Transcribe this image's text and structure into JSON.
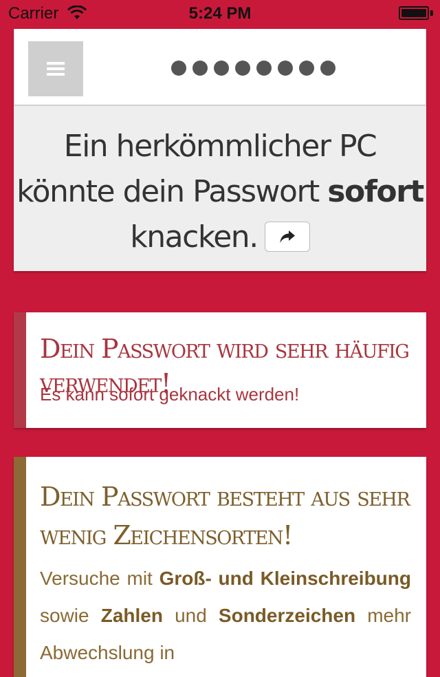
{
  "status_bar": {
    "carrier": "Carrier",
    "time": "5:24 PM"
  },
  "header": {
    "menu_icon": "hamburger-icon",
    "password_mask": "••••••••",
    "password_length": 8
  },
  "result": {
    "text_before": "Ein herkömmlicher PC könnte dein Passwort ",
    "text_bold": "sofort",
    "text_after": " knacken.",
    "share_icon": "share-arrow-icon"
  },
  "warnings": [
    {
      "title": "Dein Passwort wird sehr häufig verwendet!",
      "text": "Es kann sofort geknackt werden!",
      "color": "#b23a48"
    },
    {
      "title": "Dein Passwort besteht aus sehr wenig Zeichensorten!",
      "text_parts": [
        "Versuche mit ",
        "Groß- und Kleinschreibung",
        " sowie ",
        "Zahlen",
        " und ",
        "Sonderzeichen",
        " mehr Abwechslung in"
      ],
      "color": "#8d6a35"
    }
  ],
  "colors": {
    "background": "#c8193a",
    "card_grey": "#eeeeee",
    "warning_red": "#b23a48",
    "warning_brown": "#8d6a35"
  }
}
